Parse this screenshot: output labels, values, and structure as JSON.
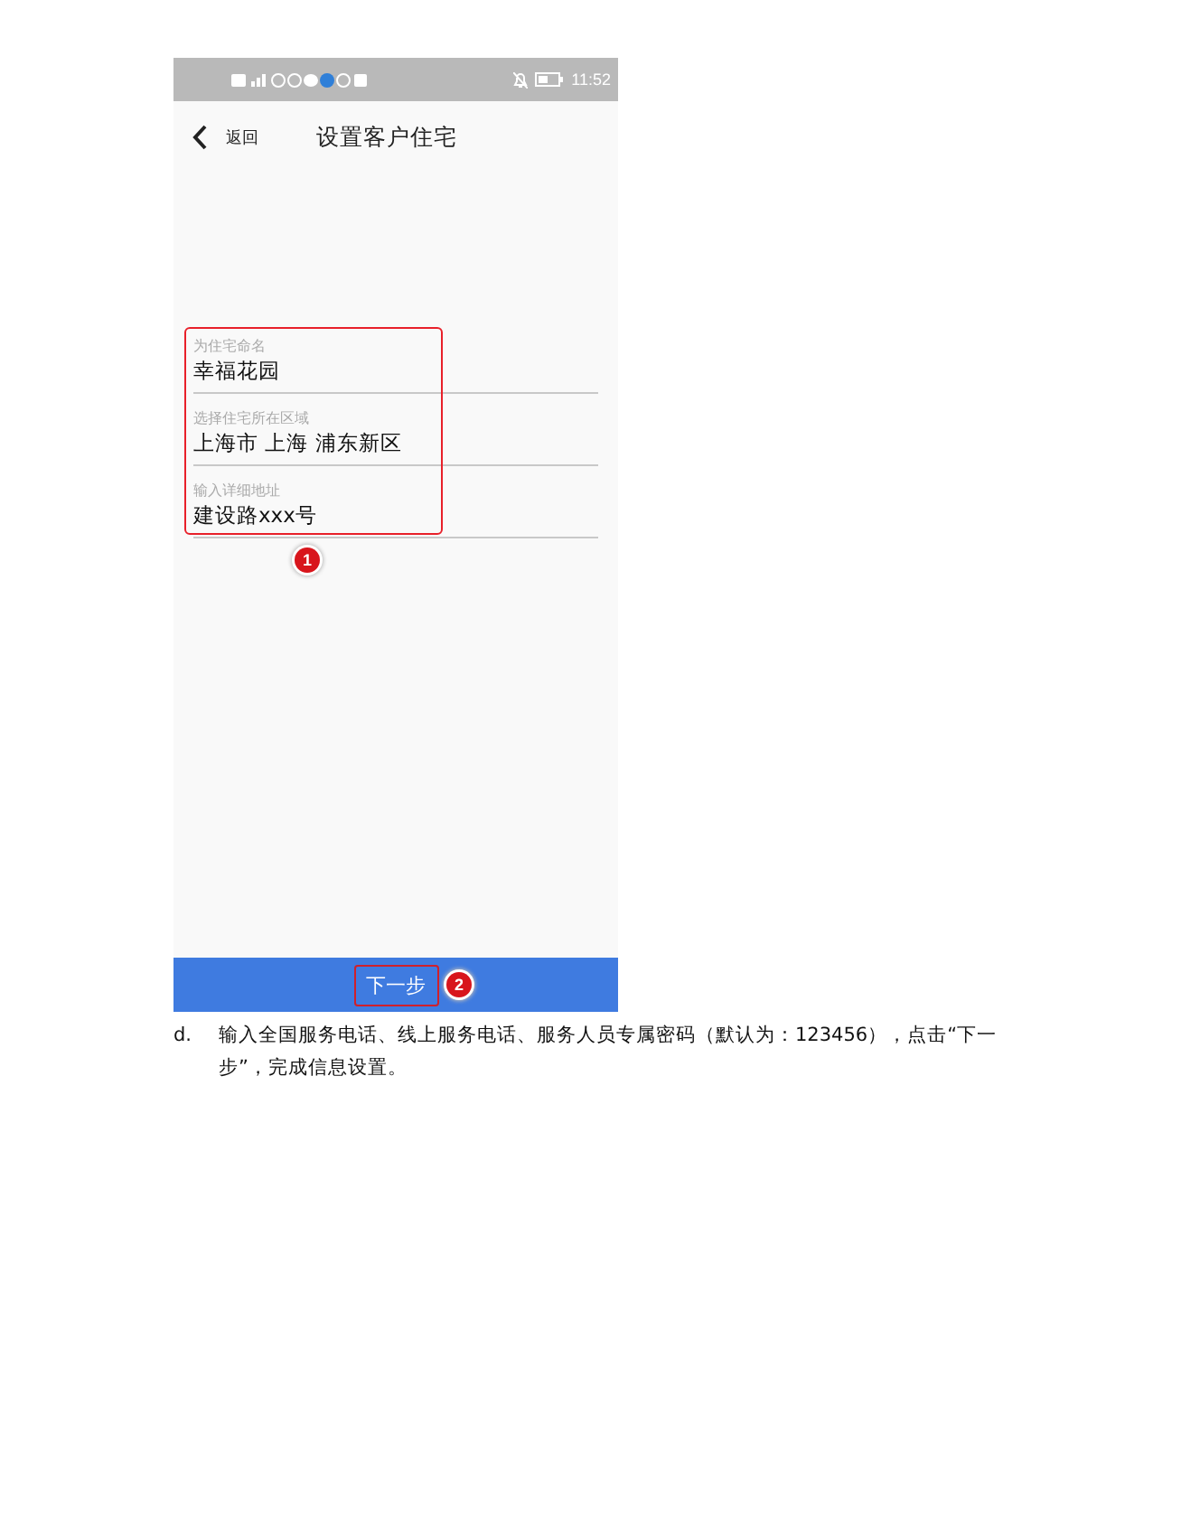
{
  "status_bar": {
    "time": "11:52"
  },
  "app_bar": {
    "back_label": "返回",
    "title": "设置客户住宅"
  },
  "fields": [
    {
      "label": "为住宅命名",
      "value": "幸福花园"
    },
    {
      "label": "选择住宅所在区域",
      "value": "上海市 上海 浦东新区"
    },
    {
      "label": "输入详细地址",
      "value": "建设路xxx号"
    }
  ],
  "next_button": {
    "label": "下一步"
  },
  "callouts": [
    {
      "number": "1"
    },
    {
      "number": "2"
    }
  ],
  "step": {
    "marker": "d.",
    "text": "输入全国服务电话、线上服务电话、服务人员专属密码（默认为：123456），点击“下一步”，完成信息设置。"
  }
}
